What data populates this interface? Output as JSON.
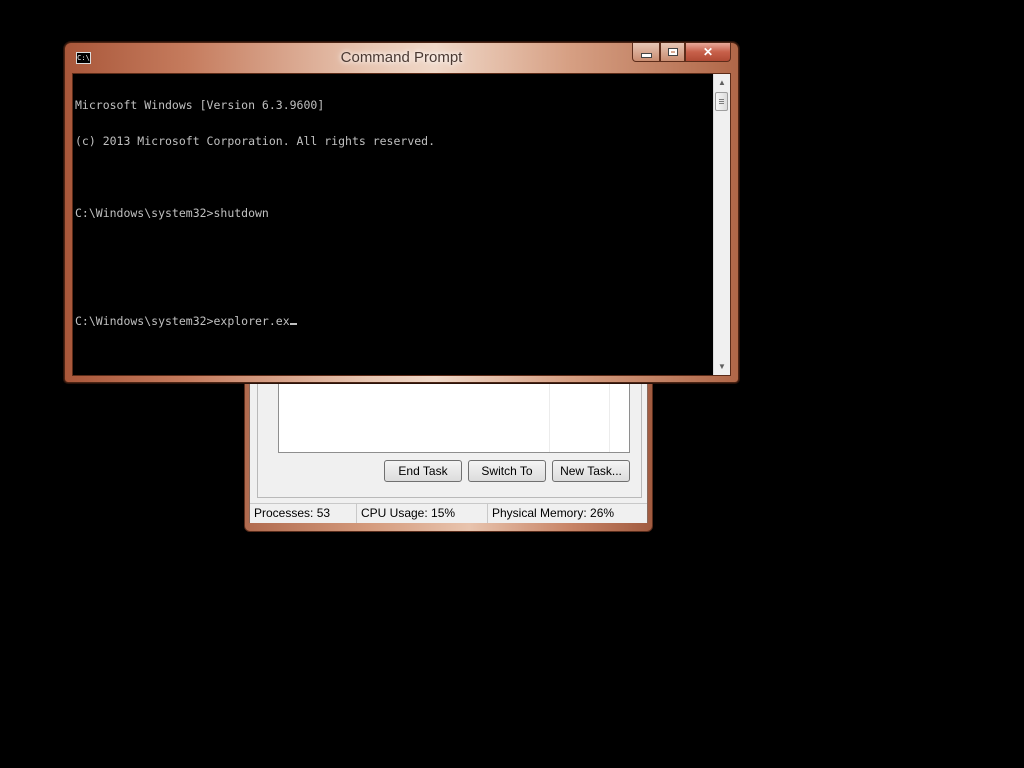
{
  "cmd_window": {
    "title": "Command Prompt",
    "icon": "console-icon",
    "icon_text": "C:\\",
    "min_label": "",
    "max_label": "",
    "close_label": "✕",
    "lines": [
      "Microsoft Windows [Version 6.3.9600]",
      "(c) 2013 Microsoft Corporation. All rights reserved.",
      "",
      "C:\\Windows\\system32>shutdown",
      "",
      "",
      "C:\\Windows\\system32>explorer.ex"
    ],
    "scroll_up": "▲",
    "scroll_down": "▼"
  },
  "task_manager": {
    "buttons": {
      "end_task": "End Task",
      "switch_to": "Switch To",
      "new_task": "New Task..."
    },
    "status": {
      "processes": "Processes: 53",
      "cpu": "CPU Usage: 15%",
      "memory": "Physical Memory: 26%"
    }
  },
  "colors": {
    "console_bg": "#000000",
    "console_fg": "#c0c0c0",
    "frame_accent": "#c57b5d",
    "close_button": "#c7604a"
  }
}
